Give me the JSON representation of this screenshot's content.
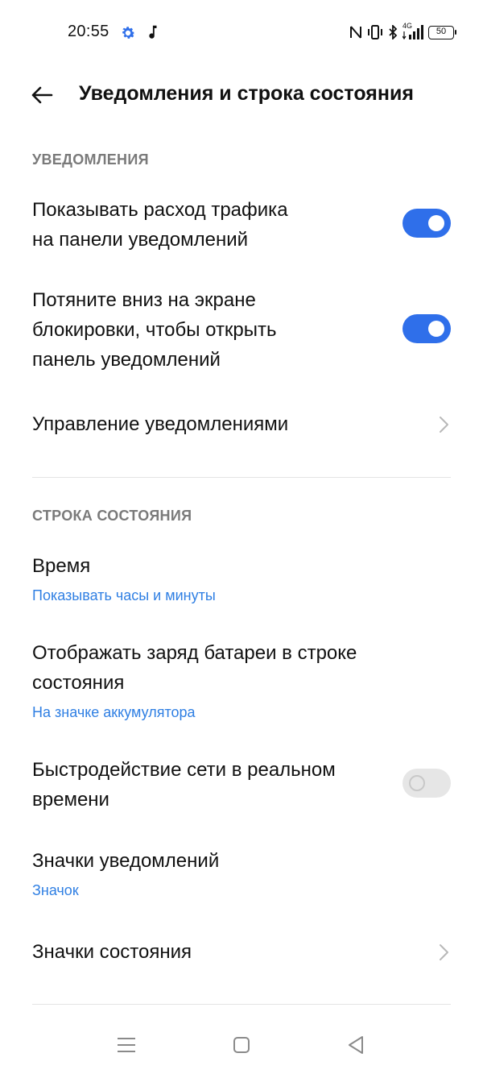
{
  "status_bar": {
    "time": "20:55",
    "battery": "50",
    "network": "4G",
    "icons": [
      "gear-icon",
      "music-note-icon",
      "nfc-icon",
      "vibrate-icon",
      "bluetooth-icon",
      "signal-icon",
      "battery-icon"
    ]
  },
  "header": {
    "title": "Уведомления и строка состояния",
    "back_icon": "arrow-left-icon"
  },
  "sections": {
    "notifications": {
      "title": "УВЕДОМЛЕНИЯ",
      "items": {
        "traffic": {
          "label_line1": "Показывать расход трафика",
          "label_line2": "на панели уведомлений",
          "enabled": true
        },
        "pulldown": {
          "label_line1": "Потяните вниз на экране",
          "label_line2": "блокировки, чтобы открыть",
          "label_line3": "панель уведомлений",
          "enabled": true
        },
        "manage": {
          "label": "Управление уведомлениями"
        }
      }
    },
    "status_bar": {
      "title": "СТРОКА СОСТОЯНИЯ",
      "items": {
        "time": {
          "label": "Время",
          "value": "Показывать часы и минуты"
        },
        "battery": {
          "label_line1": "Отображать заряд батареи в строке",
          "label_line2": "состояния",
          "value": "На значке аккумулятора"
        },
        "net_speed": {
          "label_line1": "Быстродействие сети в реальном",
          "label_line2": "времени",
          "enabled": false
        },
        "notif_icons": {
          "label": "Значки уведомлений",
          "value": "Значок"
        },
        "status_icons": {
          "label": "Значки состояния"
        }
      }
    }
  },
  "colors": {
    "accent": "#2f6fea",
    "link": "#2f7fe3",
    "section_title": "#7a7a7a",
    "toggle_off": "#e6e6e6"
  },
  "nav_bar": {
    "icons": [
      "menu-icon",
      "home-square-icon",
      "back-triangle-icon"
    ]
  }
}
